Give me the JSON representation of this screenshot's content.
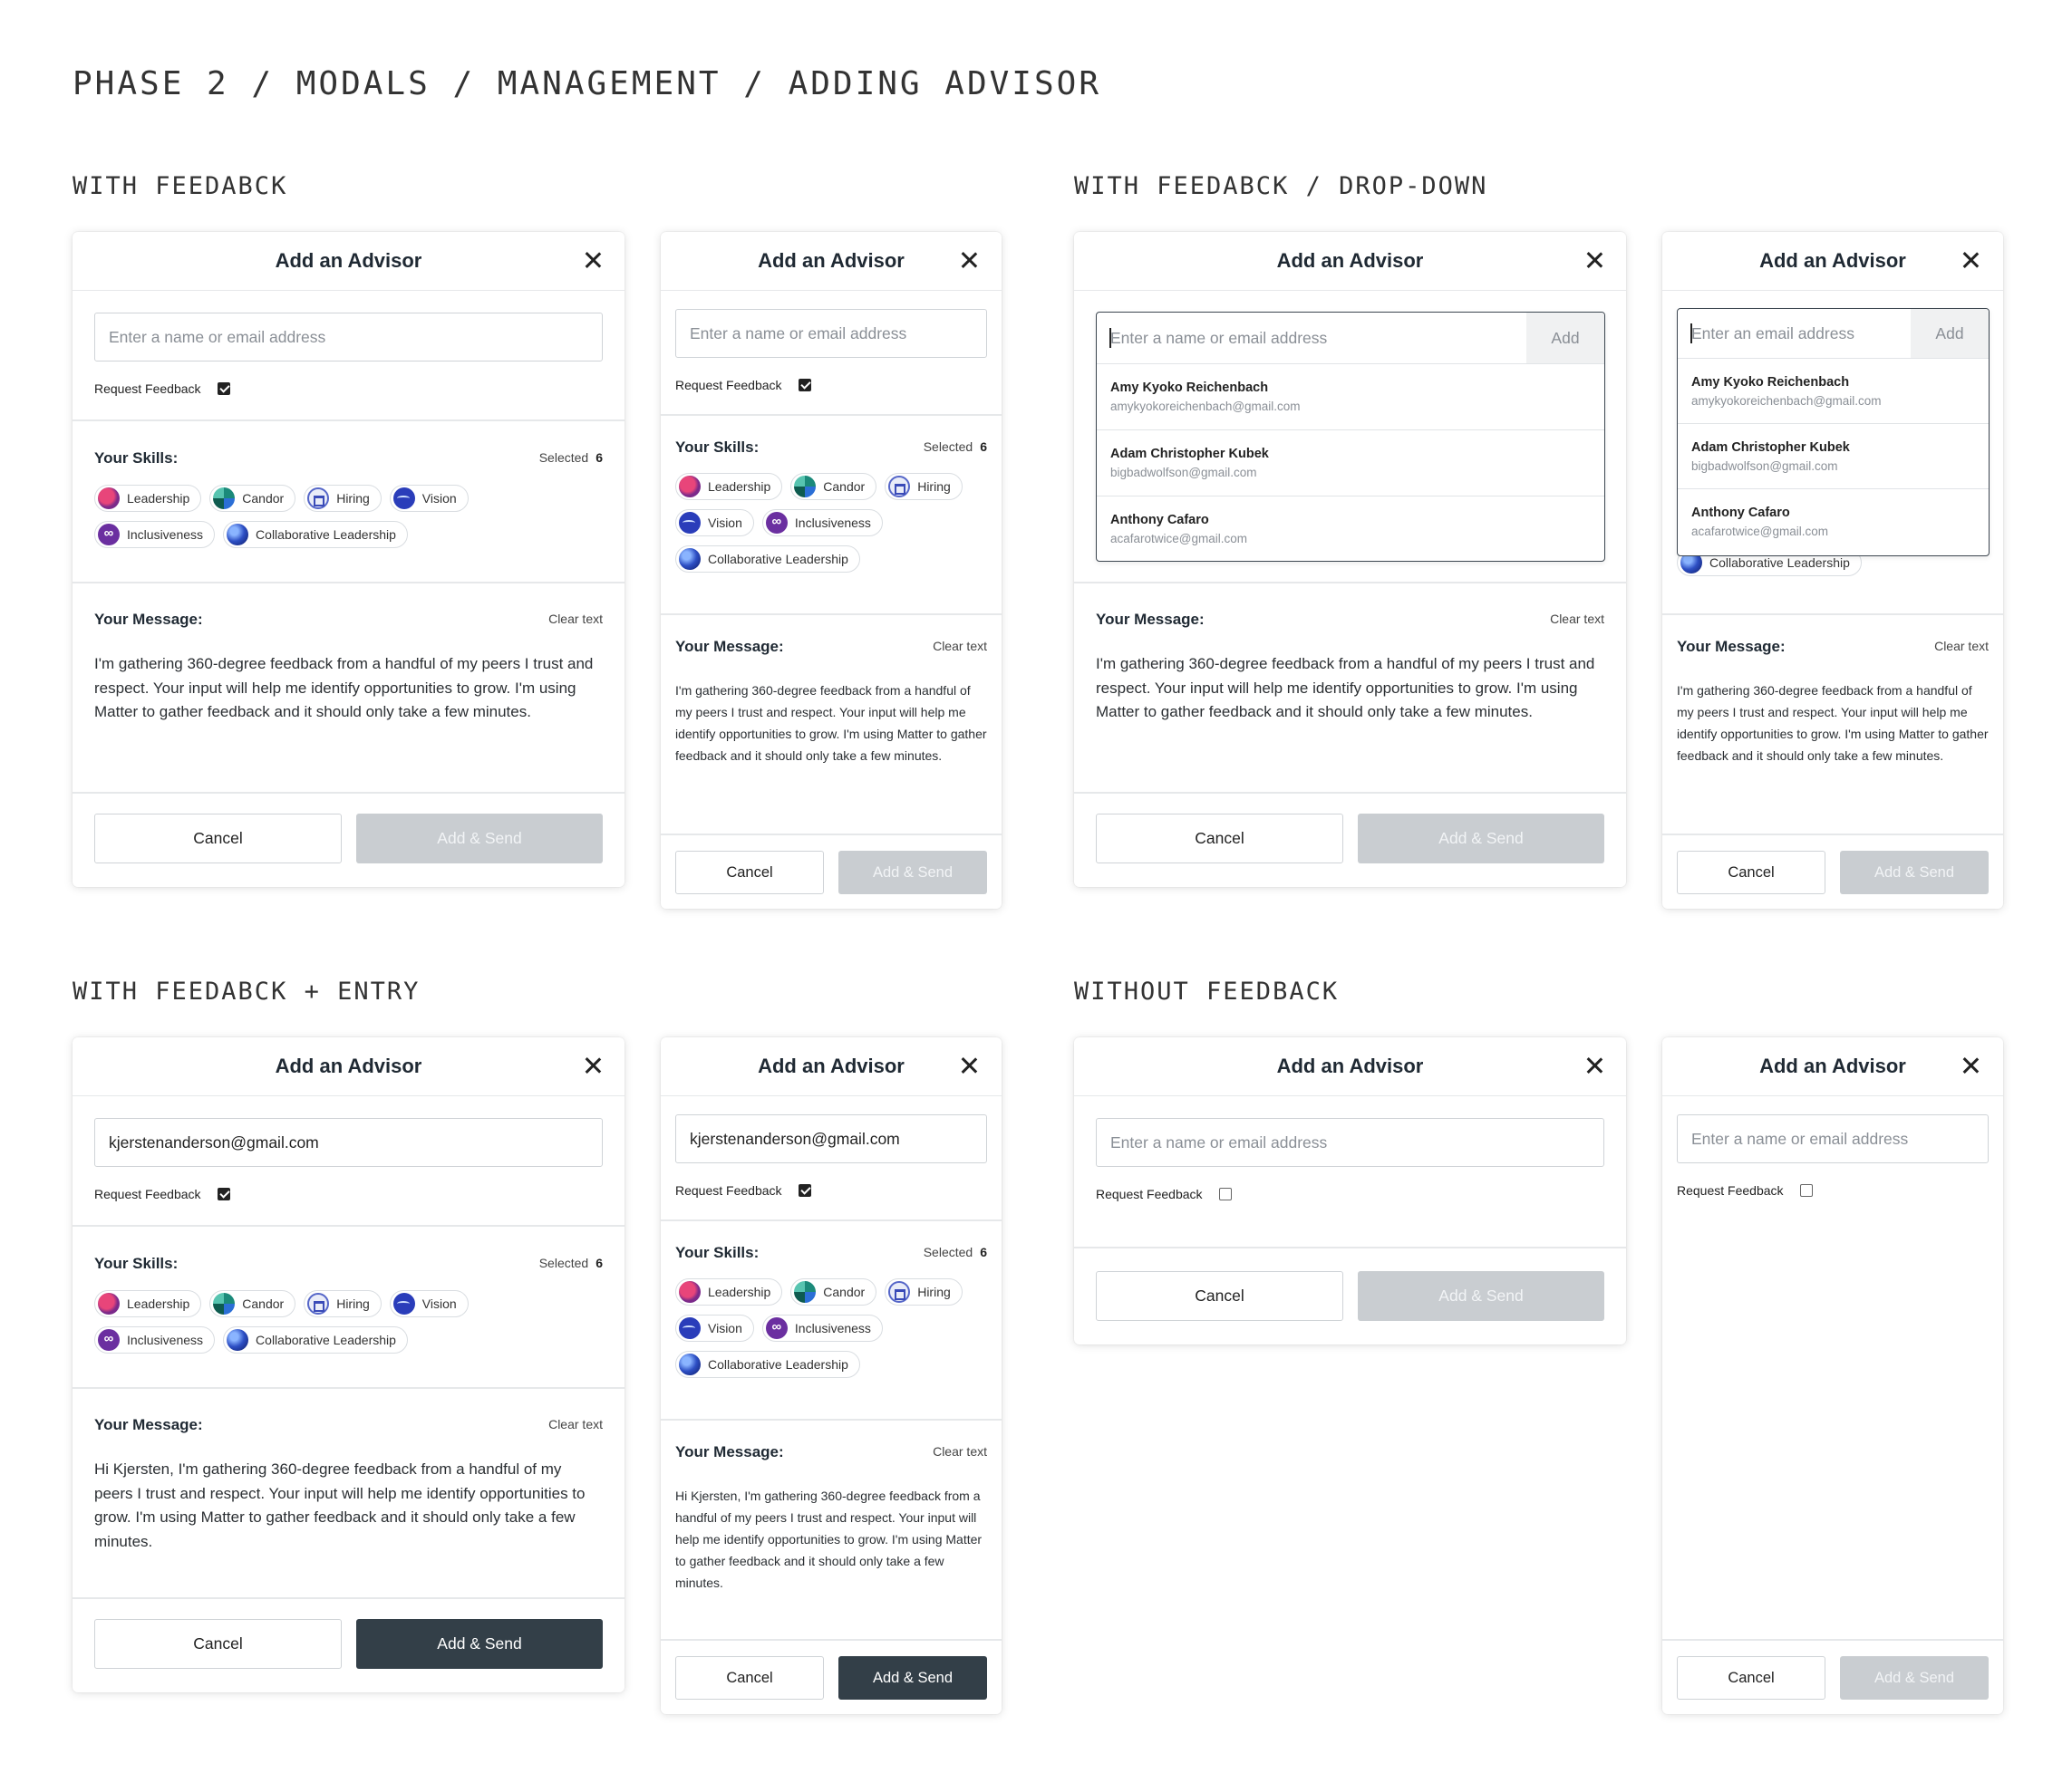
{
  "page_title": "PHASE 2 / MODALS / MANAGEMENT / ADDING ADVISOR",
  "sections": {
    "with_feedback": "WITH FEEDABCK",
    "with_feedback_dropdown": "WITH FEEDABCK / DROP-DOWN",
    "with_feedback_entry": "WITH FEEDABCK + ENTRY",
    "without_feedback": "WITHOUT FEEDBACK"
  },
  "modal": {
    "title": "Add an Advisor",
    "input_placeholder": "Enter a name or email address",
    "input_placeholder_email": "Enter an email address",
    "entered_email": "kjerstenanderson@gmail.com",
    "request_feedback": "Request Feedback",
    "skills_label": "Your Skills:",
    "selected_label": "Selected",
    "selected_count": "6",
    "message_label": "Your Message:",
    "clear_text": "Clear text",
    "cancel": "Cancel",
    "add_send": "Add & Send",
    "add": "Add"
  },
  "skills": [
    {
      "label": "Leadership",
      "icon": "leadership-icon"
    },
    {
      "label": "Candor",
      "icon": "candor-icon"
    },
    {
      "label": "Hiring",
      "icon": "hiring-icon"
    },
    {
      "label": "Vision",
      "icon": "vision-icon"
    },
    {
      "label": "Inclusiveness",
      "icon": "inclusiveness-icon"
    },
    {
      "label": "Collaborative Leadership",
      "icon": "collaborative-leadership-icon"
    }
  ],
  "messages": {
    "default": "I'm gathering 360-degree feedback from a handful of my peers I trust and respect. Your input will help me identify opportunities to grow. I'm using Matter to gather feedback and it should only take a few minutes.",
    "personalized": "Hi Kjersten, I'm gathering 360-degree feedback from a handful of my peers I trust and respect. Your input will help me identify opportunities to grow. I'm using Matter to gather feedback and it should only take a few minutes."
  },
  "suggestions": [
    {
      "name": "Amy Kyoko Reichenbach",
      "email": "amykyokoreichenbach@gmail.com"
    },
    {
      "name": "Adam Christopher Kubek",
      "email": "bigbadwolfson@gmail.com"
    },
    {
      "name": "Anthony Cafaro",
      "email": "acafarotwice@gmail.com"
    }
  ]
}
